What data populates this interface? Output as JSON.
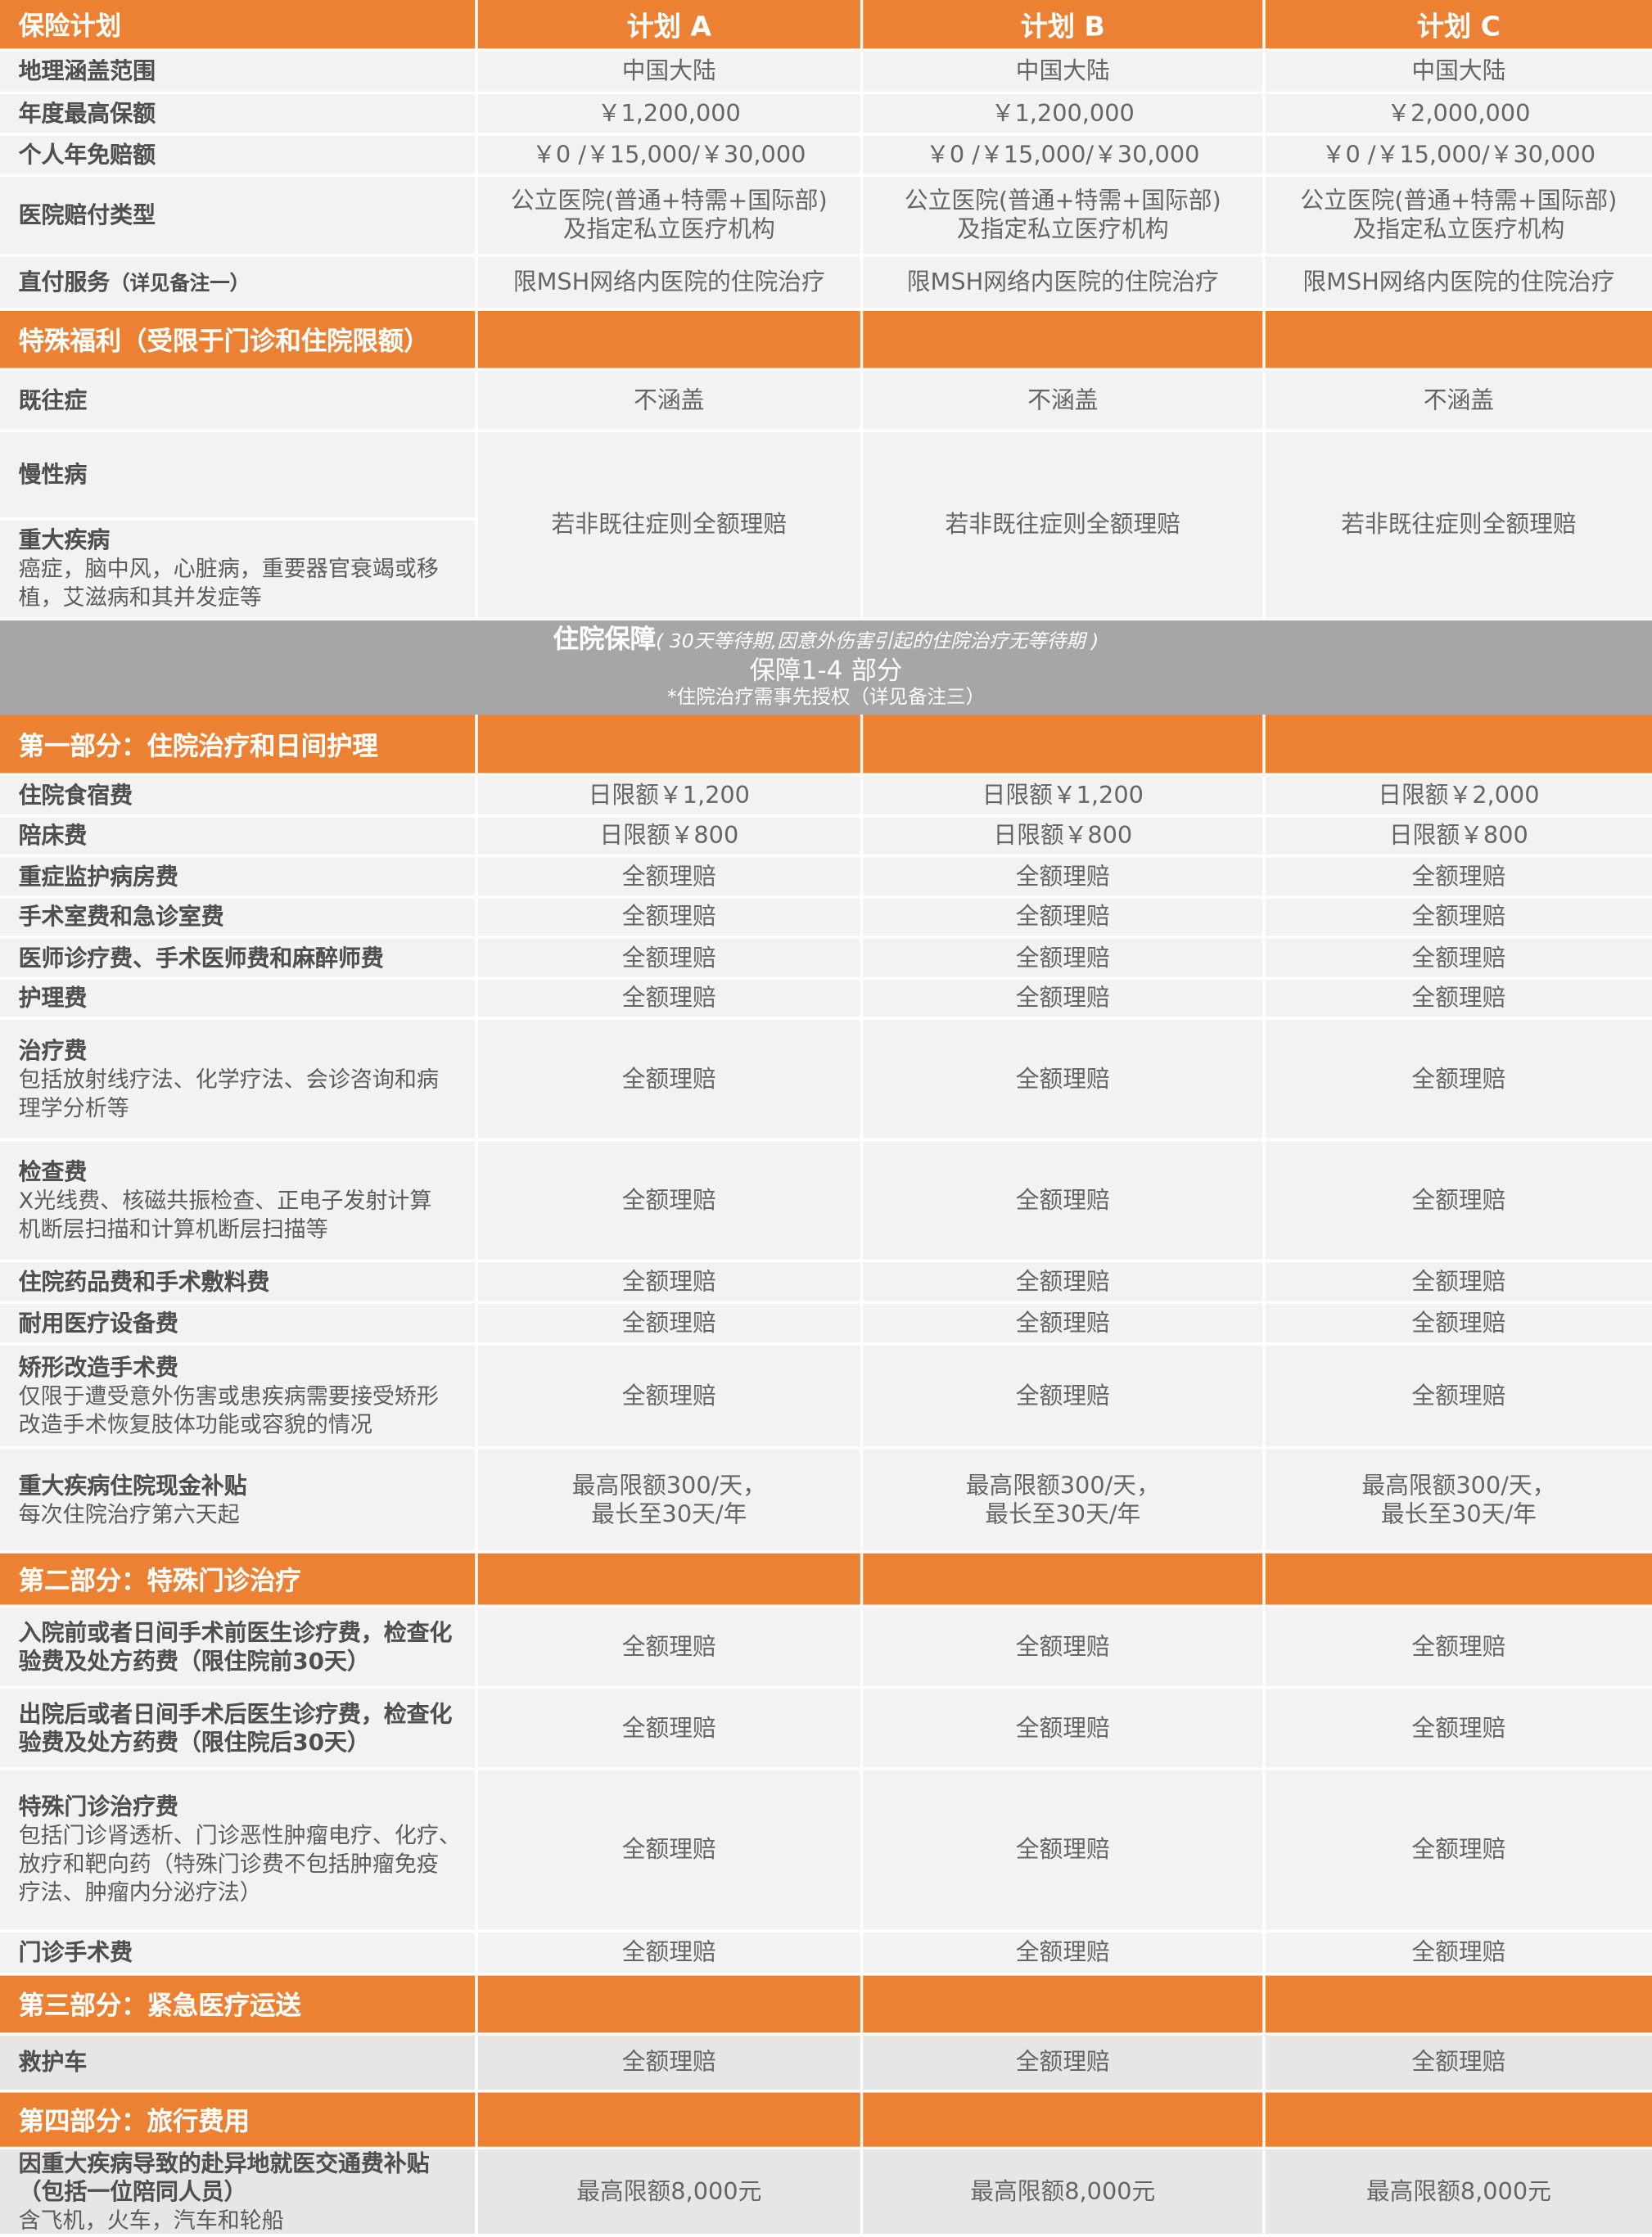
{
  "header": {
    "label": "保险计划",
    "plans": [
      "计划 A",
      "计划 B",
      "计划 C"
    ]
  },
  "general_rows": [
    {
      "label": "地理涵盖范围",
      "values": [
        "中国大陆",
        "中国大陆",
        "中国大陆"
      ]
    },
    {
      "label": "年度最高保额",
      "values": [
        "￥1,200,000",
        "￥1,200,000",
        "￥2,000,000"
      ]
    },
    {
      "label": "个人年免赔额",
      "values": [
        "￥0 /￥15,000/￥30,000",
        "￥0 /￥15,000/￥30,000",
        "￥0 /￥15,000/￥30,000"
      ]
    },
    {
      "label": "医院赔付类型",
      "values": [
        [
          "公立医院(普通+特需+国际部)",
          "及指定私立医疗机构"
        ],
        [
          "公立医院(普通+特需+国际部)",
          "及指定私立医疗机构"
        ],
        [
          "公立医院(普通+特需+国际部)",
          "及指定私立医疗机构"
        ]
      ]
    },
    {
      "label": "直付服务",
      "label_note": "（详见备注一）",
      "values": [
        "限MSH网络内医院的住院治疗",
        "限MSH网络内医院的住院治疗",
        "限MSH网络内医院的住院治疗"
      ]
    }
  ],
  "special_section": {
    "title": "特殊福利（受限于门诊和住院限额）",
    "rows": [
      {
        "label": "既往症",
        "values": [
          "不涵盖",
          "不涵盖",
          "不涵盖"
        ]
      },
      {
        "label": "慢性病"
      },
      {
        "label": "重大疾病",
        "sub": [
          "癌症，脑中风，心脏病，重要器官衰竭或移",
          "植，艾滋病和其并发症等"
        ]
      }
    ],
    "merged_value": [
      "若非既往症则全额理赔",
      "若非既往症则全额理赔",
      "若非既往症则全额理赔"
    ]
  },
  "banner": {
    "title": "住院保障",
    "title_note": "( 30天等待期,因意外伤害引起的住院治疗无等待期 )",
    "subtitle": "保障1-4 部分",
    "note": "*住院治疗需事先授权（详见备注三）"
  },
  "part1": {
    "title": "第一部分：住院治疗和日间护理",
    "rows": [
      {
        "label": "住院食宿费",
        "values": [
          "日限额￥1,200",
          "日限额￥1,200",
          "日限额￥2,000"
        ]
      },
      {
        "label": "陪床费",
        "values": [
          "日限额￥800",
          "日限额￥800",
          "日限额￥800"
        ]
      },
      {
        "label": "重症监护病房费",
        "values": [
          "全额理赔",
          "全额理赔",
          "全额理赔"
        ]
      },
      {
        "label": "手术室费和急诊室费",
        "values": [
          "全额理赔",
          "全额理赔",
          "全额理赔"
        ]
      },
      {
        "label": "医师诊疗费、手术医师费和麻醉师费",
        "values": [
          "全额理赔",
          "全额理赔",
          "全额理赔"
        ]
      },
      {
        "label": "护理费",
        "values": [
          "全额理赔",
          "全额理赔",
          "全额理赔"
        ]
      },
      {
        "label": "治疗费",
        "sub": [
          "包括放射线疗法、化学疗法、会诊咨询和病",
          "理学分析等"
        ],
        "values": [
          "全额理赔",
          "全额理赔",
          "全额理赔"
        ]
      },
      {
        "label": "检查费",
        "sub": [
          "X光线费、核磁共振检查、正电子发射计算",
          "机断层扫描和计算机断层扫描等"
        ],
        "values": [
          "全额理赔",
          "全额理赔",
          "全额理赔"
        ]
      },
      {
        "label": "住院药品费和手术敷料费",
        "values": [
          "全额理赔",
          "全额理赔",
          "全额理赔"
        ]
      },
      {
        "label": "耐用医疗设备费",
        "values": [
          "全额理赔",
          "全额理赔",
          "全额理赔"
        ]
      },
      {
        "label": "矫形改造手术费",
        "sub": [
          "仅限于遭受意外伤害或患疾病需要接受矫形",
          "改造手术恢复肢体功能或容貌的情况"
        ],
        "values": [
          "全额理赔",
          "全额理赔",
          "全额理赔"
        ]
      },
      {
        "label": "重大疾病住院现金补贴",
        "sub": [
          "每次住院治疗第六天起"
        ],
        "values": [
          [
            "最高限额300/天，",
            "最长至30天/年"
          ],
          [
            "最高限额300/天，",
            "最长至30天/年"
          ],
          [
            "最高限额300/天，",
            "最长至30天/年"
          ]
        ]
      }
    ]
  },
  "part2": {
    "title": "第二部分：特殊门诊治疗",
    "rows": [
      {
        "label_lines": [
          "入院前或者日间手术前医生诊疗费，检查化",
          "验费及处方药费（限住院前30天）"
        ],
        "values": [
          "全额理赔",
          "全额理赔",
          "全额理赔"
        ]
      },
      {
        "label_lines": [
          "出院后或者日间手术后医生诊疗费，检查化",
          "验费及处方药费（限住院后30天）"
        ],
        "values": [
          "全额理赔",
          "全额理赔",
          "全额理赔"
        ]
      },
      {
        "label": "特殊门诊治疗费",
        "sub": [
          "包括门诊肾透析、门诊恶性肿瘤电疗、化疗、",
          "放疗和靶向药（特殊门诊费不包括肿瘤免疫",
          "疗法、肿瘤内分泌疗法）"
        ],
        "values": [
          "全额理赔",
          "全额理赔",
          "全额理赔"
        ]
      },
      {
        "label": "门诊手术费",
        "values": [
          "全额理赔",
          "全额理赔",
          "全额理赔"
        ]
      }
    ]
  },
  "part3": {
    "title": "第三部分：紧急医疗运送",
    "rows": [
      {
        "label": "救护车",
        "values": [
          "全额理赔",
          "全额理赔",
          "全额理赔"
        ]
      }
    ]
  },
  "part4": {
    "title": "第四部分：旅行费用",
    "rows": [
      {
        "label_lines": [
          "因重大疾病导致的赴异地就医交通费补贴",
          "（包括一位陪同人员）"
        ],
        "sub": [
          "含飞机，火车，汽车和轮船"
        ],
        "values": [
          "最高限额8,000元",
          "最高限额8,000元",
          "最高限额8,000元"
        ]
      }
    ]
  },
  "colors": {
    "orange": "#ec8133",
    "banner_gray": "#a6a6a6",
    "row_light": "#f2f2f2"
  }
}
